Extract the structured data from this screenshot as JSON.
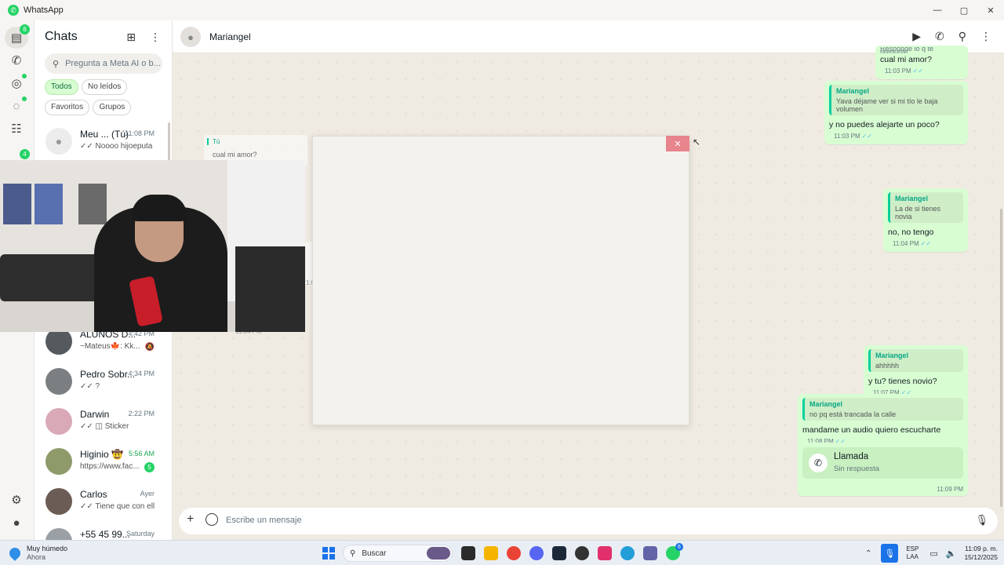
{
  "window": {
    "title": "WhatsApp",
    "minimize": "—",
    "maximize": "▢",
    "close": "✕"
  },
  "rail": {
    "chats_badge": "6",
    "communities_badge": "4"
  },
  "sidebar": {
    "title": "Chats",
    "search_placeholder": "Pregunta a Meta AI o b...",
    "filters": [
      "Todos",
      "No leídos",
      "Favoritos",
      "Grupos"
    ],
    "chats": [
      {
        "name": "Meu ...",
        "tag": "(Tú)",
        "time": "11:08 PM",
        "preview": "✓✓ Noooo hijoeputa ...",
        "avatar_color": "#ececec"
      },
      {
        "name": "ALUNOS D...",
        "time": "4:42 PM",
        "preview": "~Mateus🍁: Kk...",
        "muted": true,
        "avatar_color": "#555a5e"
      },
      {
        "name": "Pedro Sobr...",
        "time": "4:34 PM",
        "preview": "✓✓ ?",
        "avatar_color": "#7c7f81"
      },
      {
        "name": "Darwin",
        "time": "2:22 PM",
        "preview": "✓✓ ◫ Sticker",
        "avatar_color": "#d9a9b8"
      },
      {
        "name": "Higinio 🤠",
        "time": "5:56 AM",
        "time_green": true,
        "preview": "https://www.fac...",
        "unread": "5",
        "avatar_color": "#8e9a6a"
      },
      {
        "name": "Carlos",
        "time": "Ayer",
        "preview": "✓✓ Tiene que con ella",
        "avatar_color": "#6b5d55"
      },
      {
        "name": "+55 45 99...",
        "time": "Saturday",
        "preview": "",
        "avatar_color": "#9aa0a3"
      }
    ]
  },
  "conversation": {
    "contact": "Mariangel",
    "composer_placeholder": "Escribe un mensaje",
    "messages": [
      {
        "quote_name": "",
        "quote_text": "Responde lo q te pregunte",
        "text": "cual mi amor?",
        "time": "11:03 PM"
      },
      {
        "quote_name": "Mariangel",
        "quote_text": "Yava déjame ver si mi tío le baja volumen",
        "text": "y no puedes alejarte un poco?",
        "time": "11:03 PM"
      },
      {
        "quote_name": "Mariangel",
        "quote_text": "La de si tienes novia",
        "text": "no, no tengo",
        "time": "11:04 PM"
      },
      {
        "quote_name": "Mariangel",
        "quote_text": "ahhhhh",
        "text": "y tu? tienes novio?",
        "time": "11:07 PM"
      },
      {
        "quote_name": "Mariangel",
        "quote_text": "no pq está trancada la calle",
        "text": "mandame un audio quiero escucharte",
        "time": "11:08 PM"
      }
    ],
    "call": {
      "title": "Llamada",
      "subtitle": "Sin respuesta",
      "time": "11:09 PM"
    },
    "background_snippets": {
      "tu_label": "Tú",
      "tu_text": "cual mi amor?",
      "time_a": "1:04 PM",
      "time_b": "11:04 PM"
    }
  },
  "popup": {
    "close_label": "✕"
  },
  "taskbar": {
    "weather_title": "Muy húmedo",
    "weather_sub": "Ahora",
    "search": "Buscar",
    "whatsapp_badge": "6",
    "lang_1": "ESP",
    "lang_2": "LAA",
    "time": "11:09 p. m.",
    "date": "15/12/2025"
  },
  "colors": {
    "accent": "#25d366",
    "bubble_out": "#d9fdd3",
    "close_red": "#e8848c"
  }
}
